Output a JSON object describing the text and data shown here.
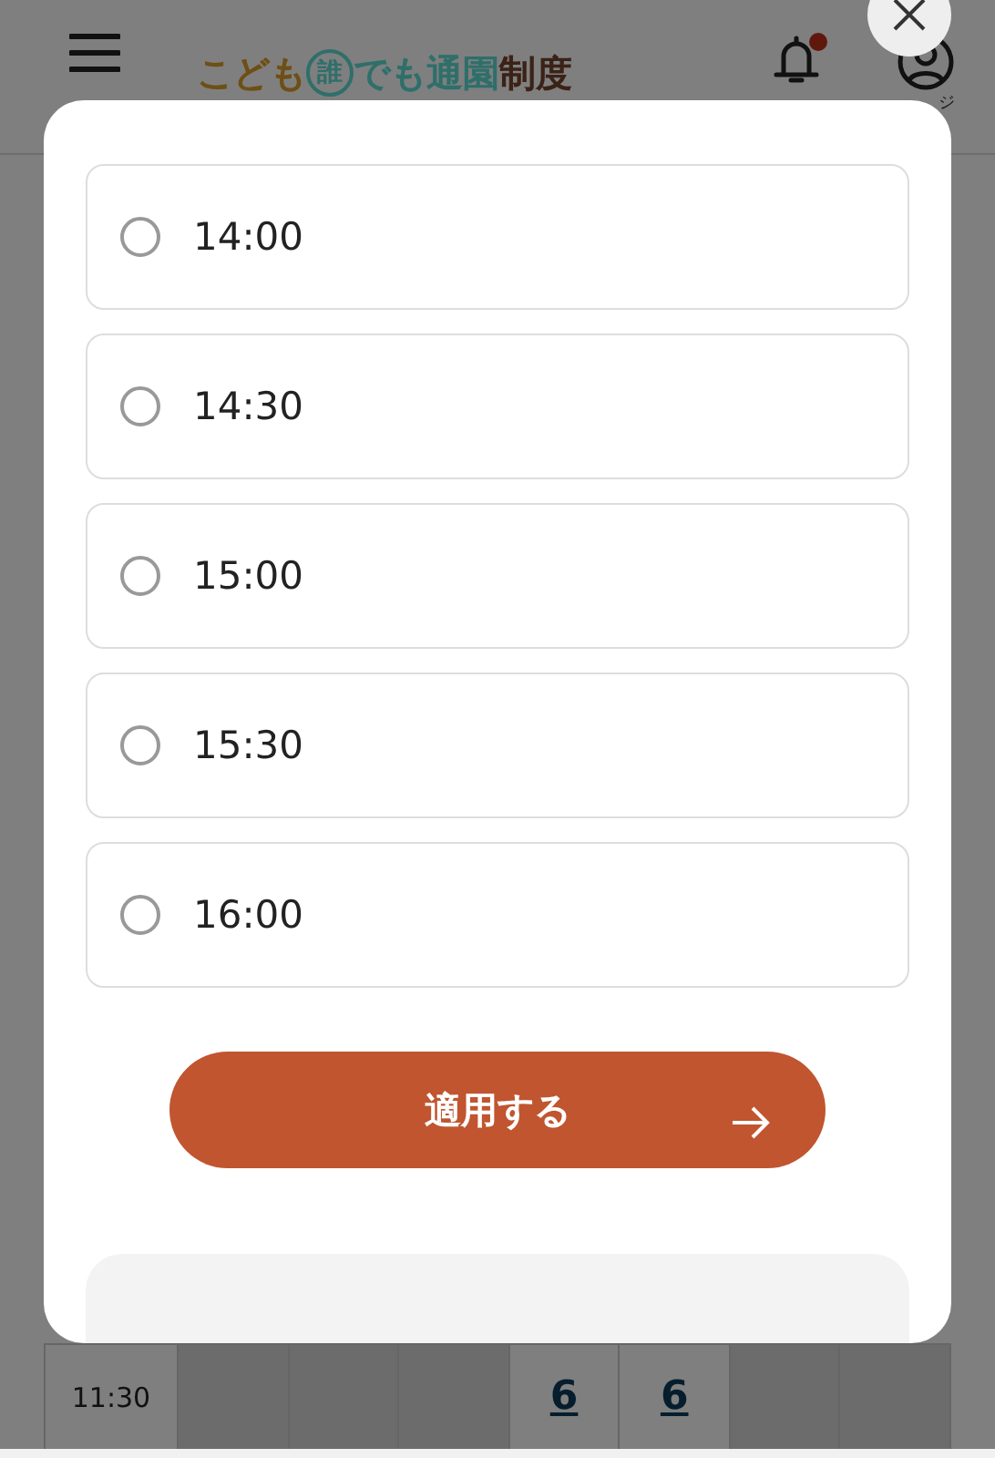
{
  "header": {
    "logo": [
      {
        "text": "こども",
        "kind": "plain",
        "color": "#6e4f14"
      },
      {
        "text": "誰",
        "kind": "circled",
        "color": "#2e6f6a"
      },
      {
        "text": "でも通園",
        "kind": "plain",
        "color": "#2e6f6a"
      },
      {
        "text": "制度",
        "kind": "plain",
        "color": "#3b2217"
      }
    ],
    "notification": true,
    "account_label": "ジ"
  },
  "table": {
    "rows": [
      {
        "time": "11:30",
        "cells": [
          {
            "available": false
          },
          {
            "available": false
          },
          {
            "available": false
          },
          {
            "available": true,
            "count": "6"
          },
          {
            "available": true,
            "count": "6"
          },
          {
            "available": false
          },
          {
            "available": false
          }
        ]
      }
    ]
  },
  "dialog": {
    "options": [
      {
        "label": "14:00",
        "selected": false
      },
      {
        "label": "14:30",
        "selected": false
      },
      {
        "label": "15:00",
        "selected": false
      },
      {
        "label": "15:30",
        "selected": false
      },
      {
        "label": "16:00",
        "selected": false
      }
    ],
    "apply_button": "適用する"
  }
}
